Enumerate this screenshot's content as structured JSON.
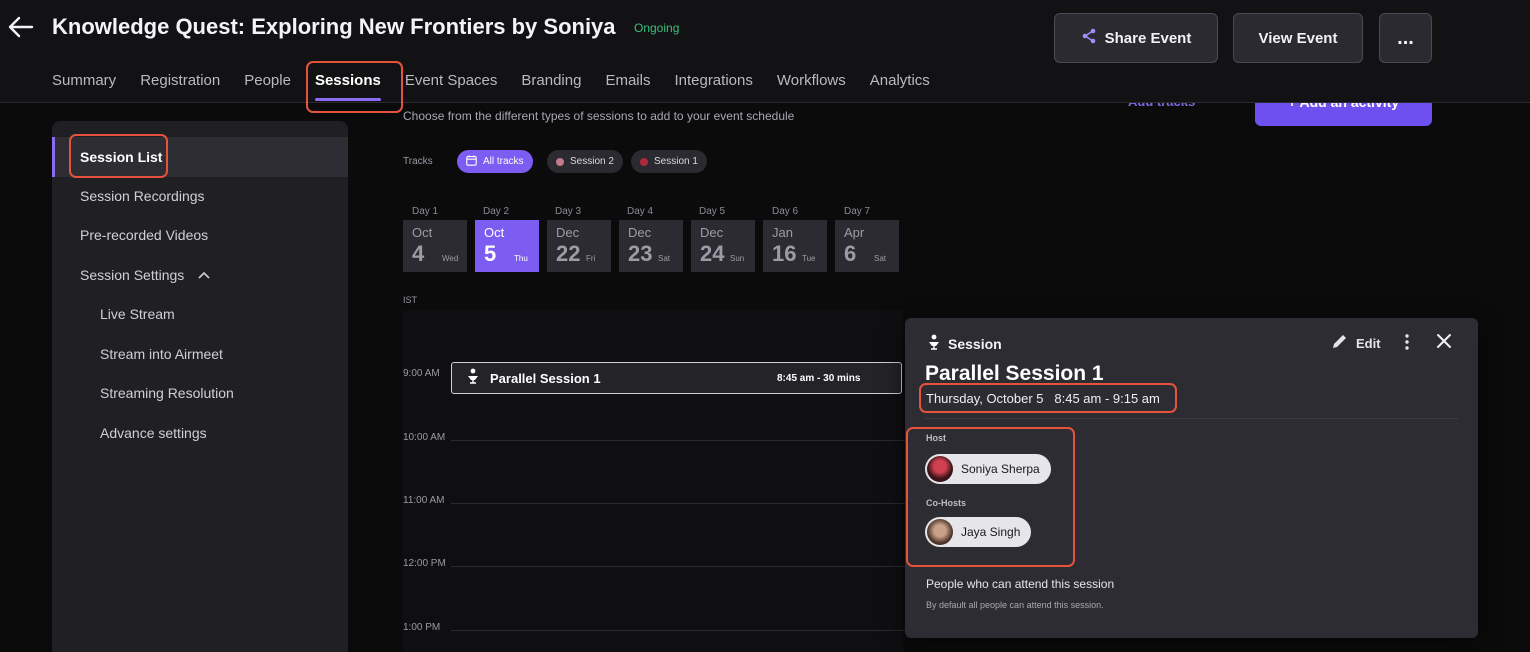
{
  "header": {
    "title": "Knowledge Quest: Exploring New Frontiers by Soniya",
    "status": "Ongoing",
    "share_label": "Share Event",
    "view_label": "View Event",
    "more_label": "...",
    "tabs": [
      {
        "label": "Summary"
      },
      {
        "label": "Registration"
      },
      {
        "label": "People"
      },
      {
        "label": "Sessions"
      },
      {
        "label": "Event Spaces"
      },
      {
        "label": "Branding"
      },
      {
        "label": "Emails"
      },
      {
        "label": "Integrations"
      },
      {
        "label": "Workflows"
      },
      {
        "label": "Analytics"
      }
    ],
    "active_tab": "Sessions"
  },
  "sidebar": {
    "items": [
      {
        "label": "Session List",
        "active": true
      },
      {
        "label": "Session Recordings"
      },
      {
        "label": "Pre-recorded Videos"
      },
      {
        "label": "Session Settings",
        "expanded": true
      },
      {
        "label": "Live Stream",
        "sub": true
      },
      {
        "label": "Stream into Airmeet",
        "sub": true
      },
      {
        "label": "Streaming Resolution",
        "sub": true
      },
      {
        "label": "Advance settings",
        "sub": true
      }
    ]
  },
  "main": {
    "subtitle": "Choose from the different types of sessions to add to your event schedule",
    "add_tracks": "Add tracks",
    "add_activity": "+ Add an activity",
    "tracks_label": "Tracks",
    "tracks": [
      {
        "label": "All tracks",
        "active": true
      },
      {
        "label": "Session 2",
        "color": "#c07a8a"
      },
      {
        "label": "Session 1",
        "color": "#b0283c"
      }
    ],
    "days": [
      {
        "label": "Day 1",
        "mon": "Oct",
        "num": "4",
        "dow": "Wed"
      },
      {
        "label": "Day 2",
        "mon": "Oct",
        "num": "5",
        "dow": "Thu",
        "active": true
      },
      {
        "label": "Day 3",
        "mon": "Dec",
        "num": "22",
        "dow": "Fri"
      },
      {
        "label": "Day 4",
        "mon": "Dec",
        "num": "23",
        "dow": "Sat"
      },
      {
        "label": "Day 5",
        "mon": "Dec",
        "num": "24",
        "dow": "Sun"
      },
      {
        "label": "Day 6",
        "mon": "Jan",
        "num": "16",
        "dow": "Tue"
      },
      {
        "label": "Day 7",
        "mon": "Apr",
        "num": "6",
        "dow": "Sat"
      }
    ],
    "timezone": "IST",
    "hours": [
      "9:00 AM",
      "10:00 AM",
      "11:00 AM",
      "12:00 PM",
      "1:00 PM"
    ],
    "session_block": {
      "name": "Parallel Session 1",
      "time": "8:45 am - 30 mins"
    }
  },
  "popup": {
    "type_label": "Session",
    "edit_label": "Edit",
    "title": "Parallel Session 1",
    "when": "Thursday, October 5   8:45 am - 9:15 am",
    "host_label": "Host",
    "host": "Soniya Sherpa",
    "cohost_label": "Co-Hosts",
    "cohost": "Jaya Singh",
    "attend_label": "People who can attend this session",
    "attend_default": "By default all people can attend this session."
  },
  "colors": {
    "accent": "#7d5cf2",
    "highlight": "#e5533d",
    "status_green": "#3ac07c"
  }
}
